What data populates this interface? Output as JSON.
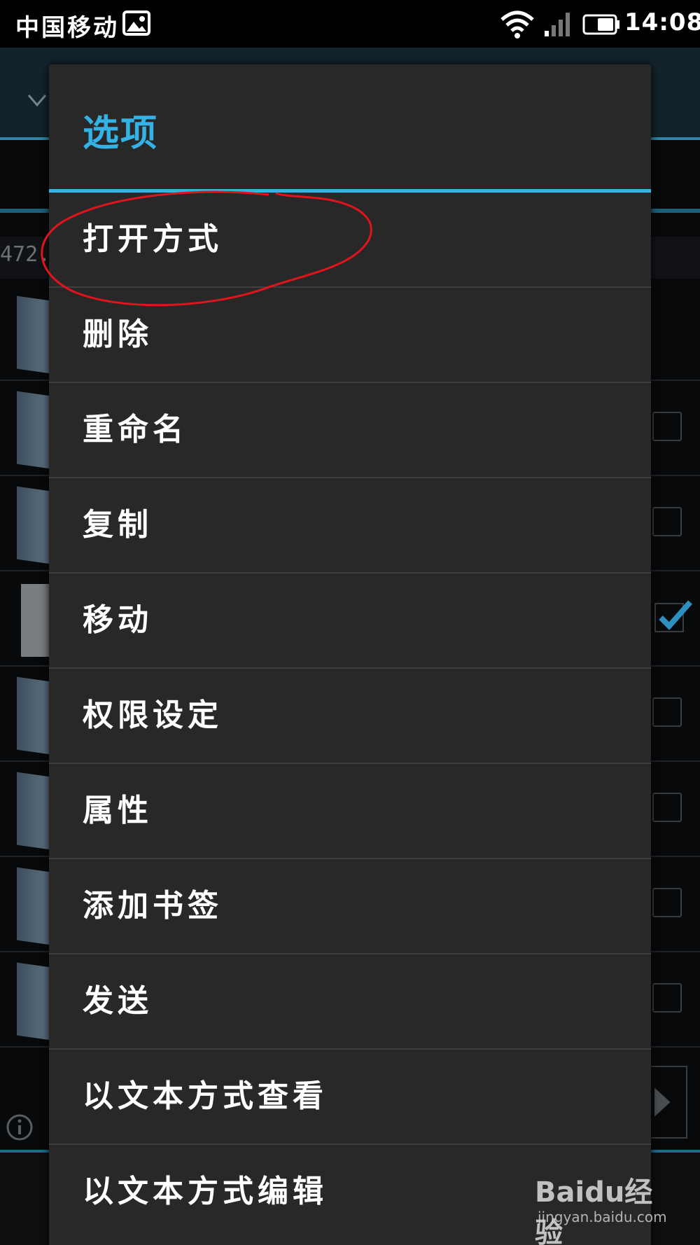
{
  "status_bar": {
    "carrier": "中国移动",
    "time": "14:08",
    "icons": [
      "gallery-icon",
      "wifi-icon",
      "signal-icon",
      "battery-icon"
    ]
  },
  "background": {
    "path_text": "472.",
    "info_icon": "info-icon"
  },
  "dialog": {
    "title": "选项",
    "accent_color": "#33b5e5",
    "items": [
      {
        "label": "打开方式"
      },
      {
        "label": "删除"
      },
      {
        "label": "重命名"
      },
      {
        "label": "复制"
      },
      {
        "label": "移动"
      },
      {
        "label": "权限设定"
      },
      {
        "label": "属性"
      },
      {
        "label": "添加书签"
      },
      {
        "label": "发送"
      },
      {
        "label": "以文本方式查看"
      },
      {
        "label": "以文本方式编辑"
      }
    ]
  },
  "watermark": {
    "logo": "Baidu经验",
    "url": "jingyan.baidu.com"
  }
}
